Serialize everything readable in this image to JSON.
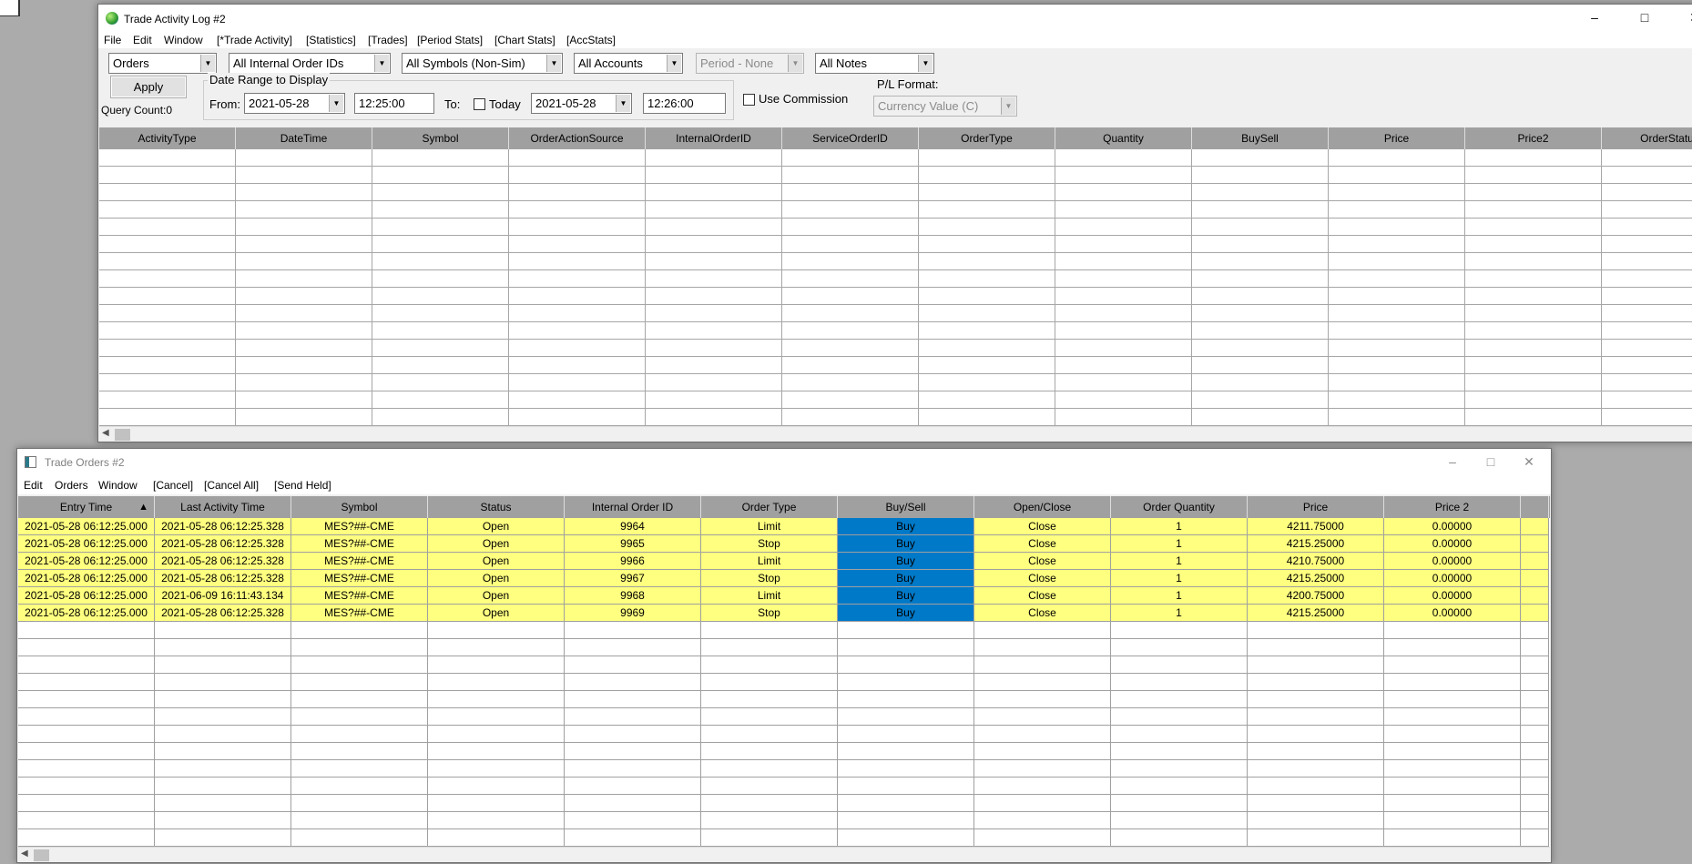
{
  "activity_log": {
    "title": "Trade Activity Log #2",
    "menu": [
      "File",
      "Edit",
      "Window",
      "[*Trade Activity]",
      "[Statistics]",
      "[Trades]",
      "[Period Stats]",
      "[Chart Stats]",
      "[AccStats]"
    ],
    "filters": {
      "type": "Orders",
      "order_ids": "All Internal Order IDs",
      "symbols": "All Symbols (Non-Sim)",
      "accounts": "All Accounts",
      "period": "Period - None",
      "notes": "All Notes"
    },
    "apply_label": "Apply",
    "query_count": "Query Count:0",
    "date_range_label": "Date Range to Display",
    "from_label": "From:",
    "from_date": "2021-05-28",
    "from_time": "12:25:00",
    "to_label": "To:",
    "today_label": "Today",
    "today_checked": false,
    "to_date": "2021-05-28",
    "to_time": "12:26:00",
    "use_commission_label": "Use Commission",
    "use_commission_checked": false,
    "pl_format_label": "P/L Format:",
    "pl_format_value": "Currency Value (C)",
    "columns": [
      "ActivityType",
      "DateTime",
      "Symbol",
      "OrderActionSource",
      "InternalOrderID",
      "ServiceOrderID",
      "OrderType",
      "Quantity",
      "BuySell",
      "Price",
      "Price2",
      "OrderStatus"
    ]
  },
  "trade_orders": {
    "title": "Trade Orders #2",
    "menu": [
      "Edit",
      "Orders",
      "Window",
      "[Cancel]",
      "[Cancel All]",
      "[Send Held]"
    ],
    "columns": [
      "Entry Time",
      "Last Activity Time",
      "Symbol",
      "Status",
      "Internal Order ID",
      "Order Type",
      "Buy/Sell",
      "Open/Close",
      "Order Quantity",
      "Price",
      "Price 2"
    ],
    "sort_indicator": "▲",
    "rows": [
      [
        "2021-05-28  06:12:25.000",
        "2021-05-28  06:12:25.328",
        "MES?##-CME",
        "Open",
        "9964",
        "Limit",
        "Buy",
        "Close",
        "1",
        "4211.75000",
        "0.00000"
      ],
      [
        "2021-05-28  06:12:25.000",
        "2021-05-28  06:12:25.328",
        "MES?##-CME",
        "Open",
        "9965",
        "Stop",
        "Buy",
        "Close",
        "1",
        "4215.25000",
        "0.00000"
      ],
      [
        "2021-05-28  06:12:25.000",
        "2021-05-28  06:12:25.328",
        "MES?##-CME",
        "Open",
        "9966",
        "Limit",
        "Buy",
        "Close",
        "1",
        "4210.75000",
        "0.00000"
      ],
      [
        "2021-05-28  06:12:25.000",
        "2021-05-28  06:12:25.328",
        "MES?##-CME",
        "Open",
        "9967",
        "Stop",
        "Buy",
        "Close",
        "1",
        "4215.25000",
        "0.00000"
      ],
      [
        "2021-05-28  06:12:25.000",
        "2021-06-09  16:11:43.134",
        "MES?##-CME",
        "Open",
        "9968",
        "Limit",
        "Buy",
        "Close",
        "1",
        "4200.75000",
        "0.00000"
      ],
      [
        "2021-05-28  06:12:25.000",
        "2021-05-28  06:12:25.328",
        "MES?##-CME",
        "Open",
        "9969",
        "Stop",
        "Buy",
        "Close",
        "1",
        "4215.25000",
        "0.00000"
      ]
    ]
  },
  "colors": {
    "row_highlight": "#ffff80",
    "buy_cell": "#0079c8",
    "header": "#a0a0a0"
  }
}
